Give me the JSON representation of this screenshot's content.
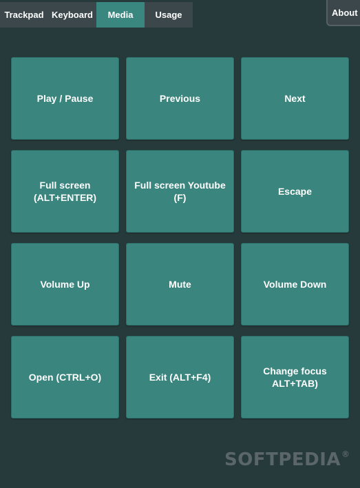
{
  "tabs": [
    {
      "label": "Trackpad",
      "active": false
    },
    {
      "label": "Keyboard",
      "active": false
    },
    {
      "label": "Media",
      "active": true
    },
    {
      "label": "Usage",
      "active": false
    }
  ],
  "about_label": "About",
  "keys": [
    "Play / Pause",
    "Previous",
    "Next",
    "Full screen\n(ALT+ENTER)",
    "Full screen Youtube\n(F)",
    "Escape",
    "Volume Up",
    "Mute",
    "Volume Down",
    "Open (CTRL+O)",
    "Exit (ALT+F4)",
    "Change focus\nALT+TAB)"
  ],
  "watermark": {
    "text": "SOFTPEDIA",
    "mark": "®"
  },
  "colors": {
    "background": "#273a3b",
    "tab": "#3b474a",
    "tab_active": "#3a877f",
    "key": "#3a857e"
  }
}
